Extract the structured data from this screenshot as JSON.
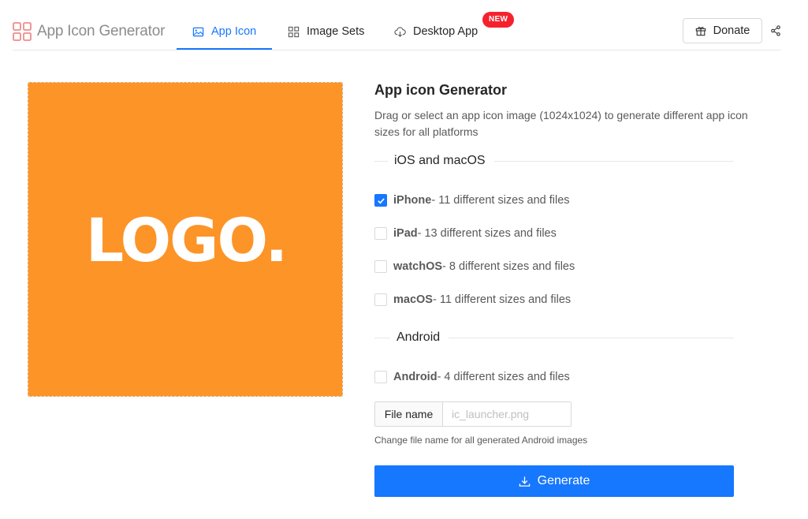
{
  "brand": {
    "title": "App Icon Generator",
    "icon": "grid-logo-icon",
    "color": "#f08c8c"
  },
  "nav": {
    "tabs": [
      {
        "label": "App Icon",
        "icon": "picture-icon",
        "active": true
      },
      {
        "label": "Image Sets",
        "icon": "appstore-icon",
        "active": false
      },
      {
        "label": "Desktop App",
        "icon": "cloud-download-icon",
        "active": false,
        "badge": "NEW"
      }
    ],
    "donate_label": "Donate",
    "donate_icon": "gift-icon",
    "share_icon": "share-icon"
  },
  "dropzone": {
    "logo_text": "LOGO.",
    "background": "#fd9427"
  },
  "panel": {
    "title": "App icon Generator",
    "description": "Drag or select an app icon image (1024x1024) to generate different app icon sizes for all platforms"
  },
  "sections": {
    "ios_title": "iOS and macOS",
    "android_title": "Android"
  },
  "options": [
    {
      "name": "iPhone",
      "detail": " - 11 different sizes and files",
      "checked": true
    },
    {
      "name": "iPad",
      "detail": " - 13 different sizes and files",
      "checked": false
    },
    {
      "name": "watchOS",
      "detail": " - 8 different sizes and files",
      "checked": false
    },
    {
      "name": "macOS",
      "detail": " - 11 different sizes and files",
      "checked": false
    },
    {
      "name": "Android",
      "detail": " - 4 different sizes and files",
      "checked": false
    }
  ],
  "filename": {
    "addon_label": "File name",
    "placeholder": "ic_launcher.png",
    "value": "",
    "help": "Change file name for all generated Android images"
  },
  "generate": {
    "label": "Generate",
    "icon": "download-icon"
  },
  "colors": {
    "primary": "#1677ff",
    "badge": "#f5222d"
  }
}
